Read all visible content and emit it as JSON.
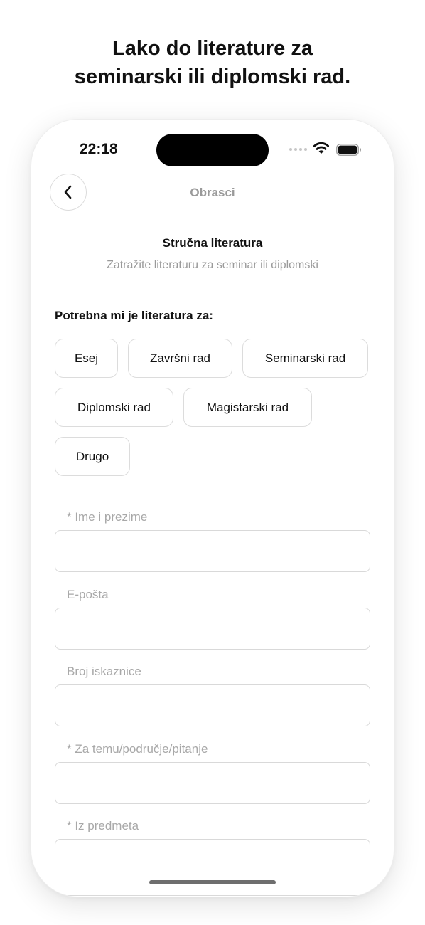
{
  "headline": {
    "line1": "Lako do literature za",
    "line2": "seminarski ili diplomski rad."
  },
  "status_bar": {
    "time": "22:18"
  },
  "nav": {
    "back_icon": "chevron-left-icon",
    "title": "Obrasci"
  },
  "form": {
    "title": "Stručna literatura",
    "subtitle": "Zatražite literaturu za seminar ili diplomski",
    "section_label": "Potrebna mi je literatura za:",
    "options": [
      "Esej",
      "Završni rad",
      "Seminarski rad",
      "Diplomski rad",
      "Magistarski rad",
      "Drugo"
    ],
    "fields": [
      {
        "label": "* Ime i prezime",
        "value": ""
      },
      {
        "label": "E-pošta",
        "value": ""
      },
      {
        "label": "Broj iskaznice",
        "value": ""
      },
      {
        "label": "* Za temu/područje/pitanje",
        "value": ""
      },
      {
        "label": "* Iz predmeta",
        "value": ""
      }
    ]
  },
  "colors": {
    "text": "#111111",
    "muted": "#9a9a9a",
    "border": "#dcdcdc"
  }
}
